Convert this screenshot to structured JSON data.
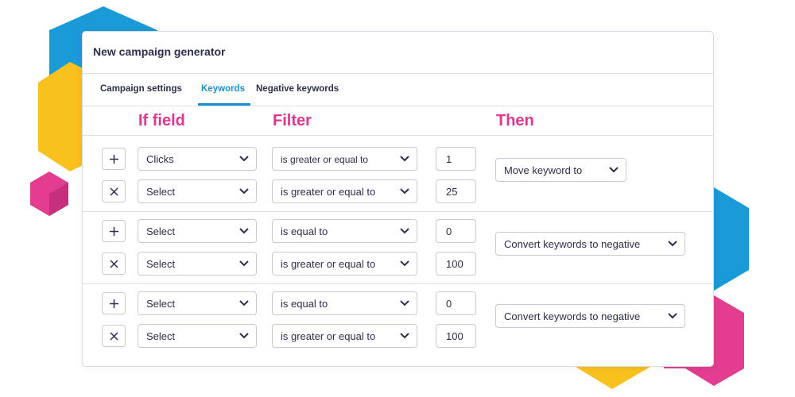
{
  "window": {
    "title": "New campaign generator"
  },
  "tabs": [
    {
      "label": "Campaign settings",
      "active": false
    },
    {
      "label": "Keywords",
      "active": true
    },
    {
      "label": "Negative keywords",
      "active": false
    }
  ],
  "columns": {
    "field": "If field",
    "filter": "Filter",
    "action": "Then"
  },
  "groups": [
    {
      "rows": [
        {
          "icon": "plus-icon",
          "field": "Clicks",
          "filter": "is greater or equal to",
          "value": "1"
        },
        {
          "icon": "close-icon",
          "field": "Select",
          "filter": "is greater or equal to",
          "value": "25"
        }
      ],
      "action": "Move keyword to"
    },
    {
      "rows": [
        {
          "icon": "plus-icon",
          "field": "Select",
          "filter": "is equal to",
          "value": "0"
        },
        {
          "icon": "close-icon",
          "field": "Select",
          "filter": "is greater or equal to",
          "value": "100"
        }
      ],
      "action": "Convert keywords to negative"
    },
    {
      "rows": [
        {
          "icon": "plus-icon",
          "field": "Select",
          "filter": "is equal to",
          "value": "0"
        },
        {
          "icon": "close-icon",
          "field": "Select",
          "filter": "is greater or equal to",
          "value": "100"
        }
      ],
      "action": "Convert keywords to negative"
    }
  ],
  "colors": {
    "accent_blue": "#1a8fd0",
    "header_pink": "#e0368f",
    "hex_blue": "#1b9ad8",
    "hex_yellow": "#f8c11e",
    "hex_pink": "#e23d8f",
    "text_dark": "#2d2f4a"
  }
}
